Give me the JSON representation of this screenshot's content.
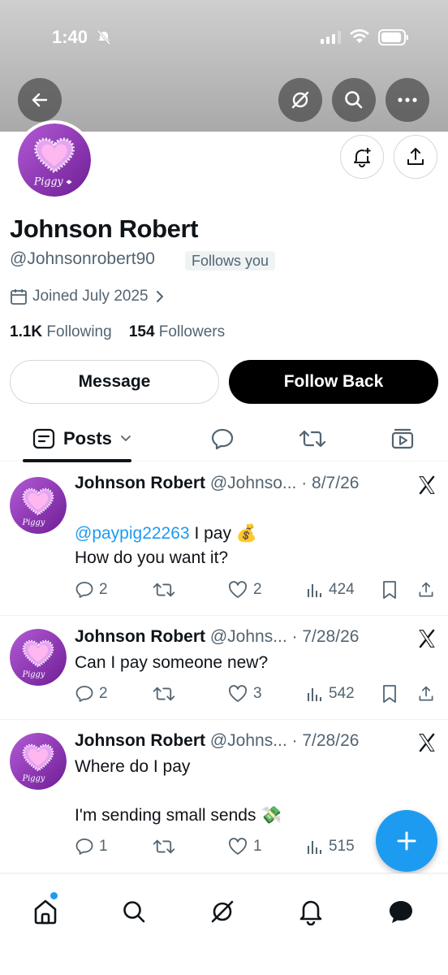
{
  "status_bar": {
    "time": "1:40"
  },
  "profile": {
    "avatar_text": "Piggy",
    "name": "Johnson Robert",
    "handle": "@Johnsonrobert90",
    "follows_you": "Follows you",
    "joined": "Joined July 2025",
    "following_count": "1.1K",
    "following_label": "Following",
    "followers_count": "154",
    "followers_label": "Followers"
  },
  "buttons": {
    "message": "Message",
    "follow_back": "Follow Back"
  },
  "tabs": {
    "posts": "Posts"
  },
  "posts": [
    {
      "name": "Johnson Robert",
      "handle_date": "@Johnso... · 8/7/26",
      "mention": "@paypig22263",
      "text_after_mention": " I pay 💰",
      "text2": "How do you want it?",
      "replies": "2",
      "likes": "2",
      "views": "424"
    },
    {
      "name": "Johnson Robert",
      "handle_date": "@Johns... · 7/28/26",
      "text": "Can I pay someone new?",
      "replies": "2",
      "likes": "3",
      "views": "542"
    },
    {
      "name": "Johnson Robert",
      "handle_date": "@Johns... · 7/28/26",
      "text": "Where do I pay",
      "text2": "I'm sending small sends 💸",
      "replies": "1",
      "likes": "1",
      "views": "515"
    }
  ],
  "colors": {
    "accent": "#1d9bf0",
    "text": "#0f1419",
    "muted": "#536471",
    "avatar_purple": "#8e2fb5"
  },
  "icons": [
    "back-arrow-icon",
    "grok-icon",
    "search-icon",
    "more-icon",
    "bell-plus-icon",
    "share-icon",
    "calendar-icon",
    "x-logo-icon",
    "home-icon",
    "bell-icon",
    "messages-icon",
    "compose-plus-icon"
  ]
}
